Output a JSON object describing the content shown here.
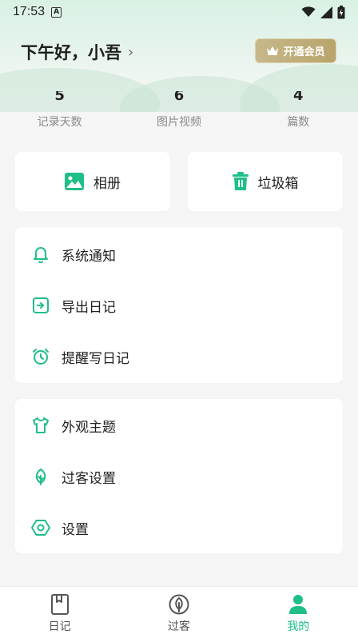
{
  "status": {
    "time": "17:53",
    "indicator": "A"
  },
  "header": {
    "greeting": "下午好，小吾",
    "chevron": "›",
    "vip_label": "开通会员"
  },
  "stats": [
    {
      "value": "5",
      "label": "记录天数"
    },
    {
      "value": "6",
      "label": "图片视频"
    },
    {
      "value": "4",
      "label": "篇数"
    }
  ],
  "quick_actions": {
    "album": "相册",
    "trash": "垃圾箱"
  },
  "menu_group_1": {
    "notifications": "系统通知",
    "export": "导出日记",
    "reminder": "提醒写日记"
  },
  "menu_group_2": {
    "theme": "外观主题",
    "guest_settings": "过客设置",
    "settings": "设置"
  },
  "tabs": {
    "diary": "日记",
    "guest": "过客",
    "mine": "我的"
  },
  "colors": {
    "accent": "#1fbf86",
    "vip_gold": "#b8a56c",
    "background": "#f4f5f4"
  }
}
